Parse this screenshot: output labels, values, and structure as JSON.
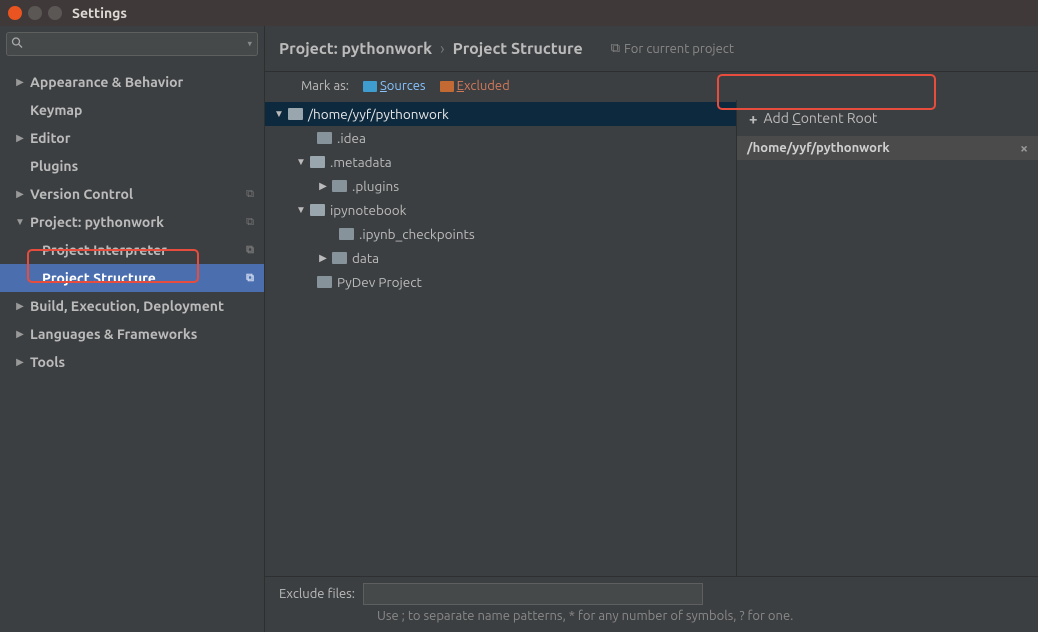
{
  "titlebar": {
    "title": "Settings"
  },
  "search": {
    "placeholder": ""
  },
  "nav": {
    "appearance": "Appearance & Behavior",
    "keymap": "Keymap",
    "editor": "Editor",
    "plugins": "Plugins",
    "version_control": "Version Control",
    "project": "Project: pythonwork",
    "project_interpreter": "Project Interpreter",
    "project_structure": "Project Structure",
    "build": "Build, Execution, Deployment",
    "languages": "Languages & Frameworks",
    "tools": "Tools"
  },
  "breadcrumbs": {
    "crumb1": "Project: pythonwork",
    "crumb2": "Project Structure",
    "for_current": "For current project"
  },
  "mark": {
    "label": "Mark as:",
    "sources_pre": "S",
    "sources_post": "ources",
    "excluded_pre": "E",
    "excluded_post": "xcluded"
  },
  "tree": {
    "root": "/home/yyf/pythonwork",
    "idea": ".idea",
    "metadata": ".metadata",
    "plugins": ".plugins",
    "ipynotebook": "ipynotebook",
    "checkpoints": ".ipynb_checkpoints",
    "data": "data",
    "pydev": "PyDev Project"
  },
  "roots": {
    "add_pre": "Add ",
    "add_u": "C",
    "add_post": "ontent Root",
    "entry": "/home/yyf/pythonwork"
  },
  "exclude": {
    "label": "Exclude files:",
    "hint": "Use ; to separate name patterns, * for any number of symbols, ? for one."
  }
}
